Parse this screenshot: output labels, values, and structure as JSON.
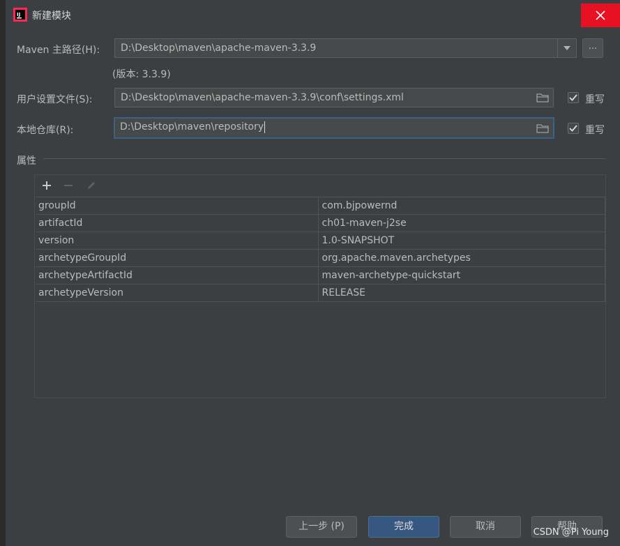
{
  "window": {
    "title": "新建模块"
  },
  "maven_home": {
    "label": "Maven 主路径(H):",
    "value": "D:\\Desktop\\maven\\apache-maven-3.3.9",
    "version_note": "(版本: 3.3.9)",
    "browse_label": "..."
  },
  "user_settings": {
    "label": "用户设置文件(S):",
    "value": "D:\\Desktop\\maven\\apache-maven-3.3.9\\conf\\settings.xml",
    "override_label": "重写",
    "override_checked": true
  },
  "local_repo": {
    "label": "本地仓库(R):",
    "value": "D:\\Desktop\\maven\\repository",
    "override_label": "重写",
    "override_checked": true
  },
  "properties": {
    "section_label": "属性",
    "rows": [
      {
        "key": "groupId",
        "value": "com.bjpowernd"
      },
      {
        "key": "artifactId",
        "value": "ch01-maven-j2se"
      },
      {
        "key": "version",
        "value": "1.0-SNAPSHOT"
      },
      {
        "key": "archetypeGroupId",
        "value": "org.apache.maven.archetypes"
      },
      {
        "key": "archetypeArtifactId",
        "value": "maven-archetype-quickstart"
      },
      {
        "key": "archetypeVersion",
        "value": "RELEASE"
      }
    ]
  },
  "buttons": {
    "previous": "上一步 (P)",
    "finish": "完成",
    "cancel": "取消",
    "help": "帮助"
  },
  "watermark": "CSDN @Pi Young",
  "colors": {
    "background": "#3c3f41",
    "close": "#e81123",
    "primary_button": "#365880",
    "focus_border": "#3d6185"
  }
}
